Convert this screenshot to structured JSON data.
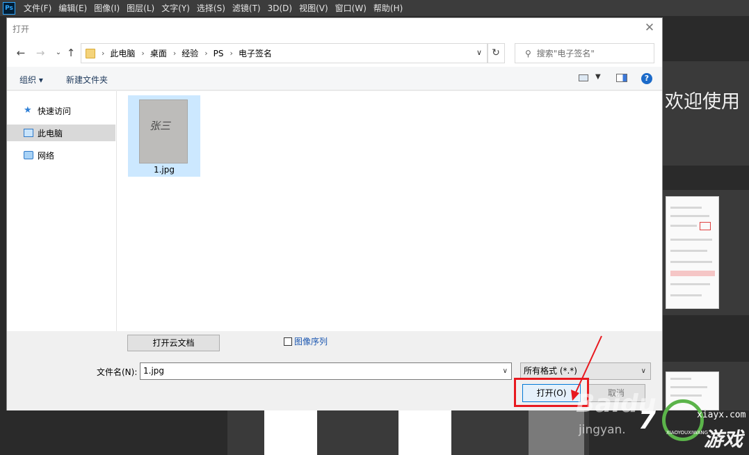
{
  "app": {
    "logo": "Ps",
    "menu": [
      "文件(F)",
      "编辑(E)",
      "图像(I)",
      "图层(L)",
      "文字(Y)",
      "选择(S)",
      "滤镜(T)",
      "3D(D)",
      "视图(V)",
      "窗口(W)",
      "帮助(H)"
    ],
    "welcome_text": "欢迎使用"
  },
  "dialog": {
    "title": "打开",
    "close_icon": "close-icon",
    "breadcrumb": [
      "此电脑",
      "桌面",
      "经验",
      "PS",
      "电子签名"
    ],
    "search_placeholder": "搜索\"电子签名\"",
    "toolbar": {
      "organize": "组织 ▾",
      "new_folder": "新建文件夹"
    },
    "nav_items": [
      {
        "label": "快速访问",
        "icon": "star-icon",
        "selected": false
      },
      {
        "label": "此电脑",
        "icon": "computer-icon",
        "selected": true
      },
      {
        "label": "网络",
        "icon": "network-icon",
        "selected": false
      }
    ],
    "files": [
      {
        "name": "1.jpg",
        "thumb_text": "张三",
        "selected": true
      }
    ],
    "bottom": {
      "cloud_button": "打开云文档",
      "sequence_label": "图像序列",
      "filename_label": "文件名(N):",
      "filename_value": "1.jpg",
      "filetype_value": "所有格式 (*.*)",
      "open_button": "打开(O)",
      "cancel_button": "取消"
    }
  },
  "annotation": {
    "highlight_color": "#e8191f"
  },
  "watermarks": {
    "baidu": "Baidu",
    "jingyan": "jingyan.",
    "site": "xiayx.com",
    "game": "游戏",
    "pinyin": "XIAOYOUXIWANG",
    "seven": "7"
  }
}
